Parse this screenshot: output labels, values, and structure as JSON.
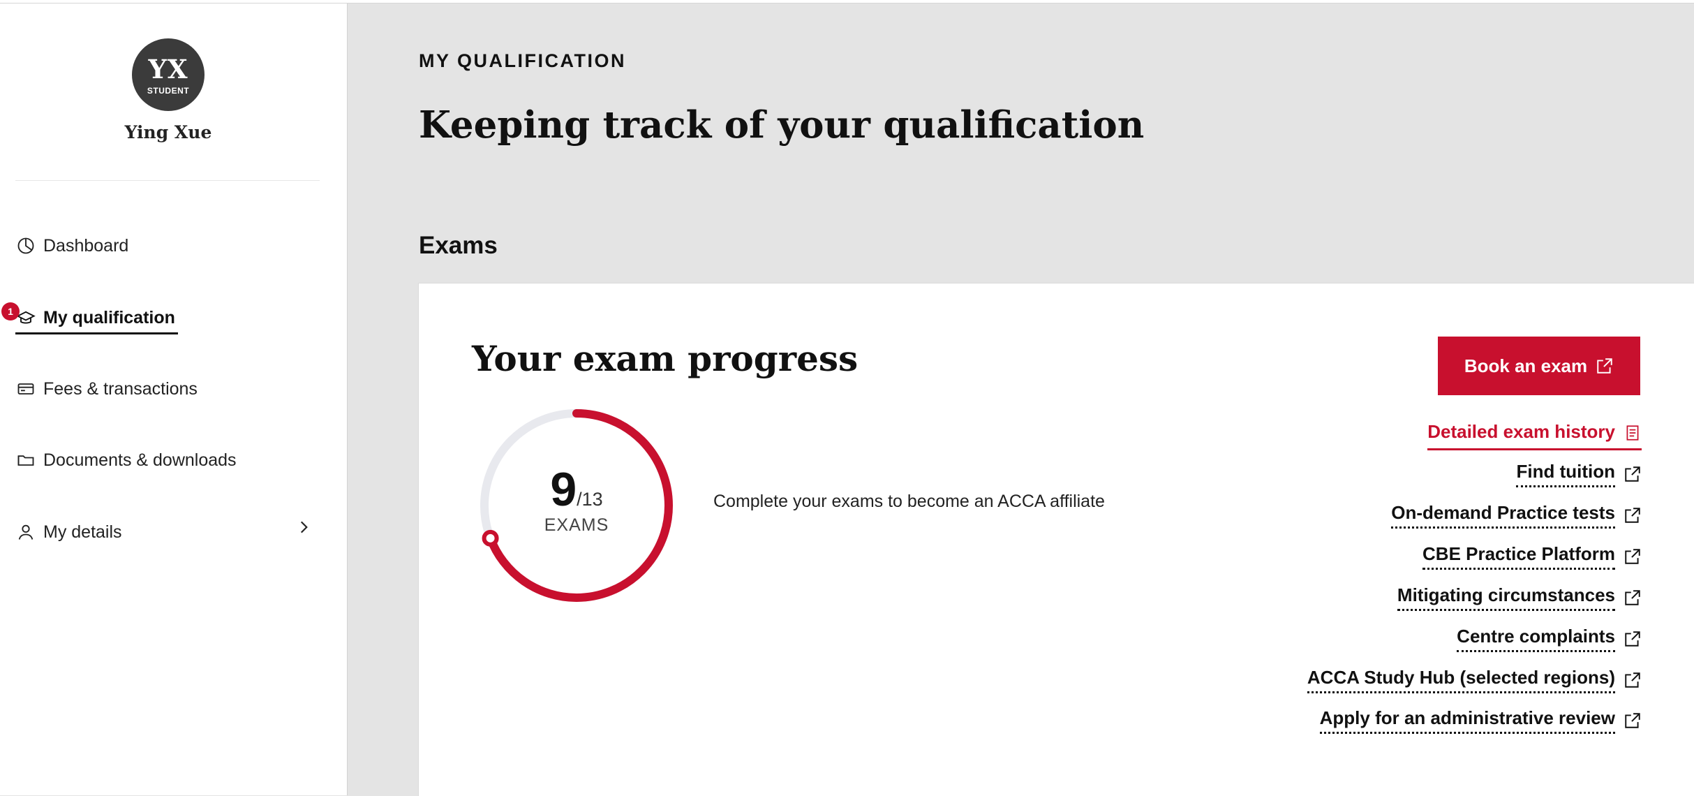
{
  "profile": {
    "initials": "YX",
    "role": "STUDENT",
    "name": "Ying Xue"
  },
  "nav": {
    "items": [
      {
        "label": "Dashboard",
        "icon": "pie-chart-icon"
      },
      {
        "label": "My qualification",
        "icon": "graduation-cap-icon",
        "badge": "1",
        "active": true
      },
      {
        "label": "Fees & transactions",
        "icon": "credit-card-icon"
      },
      {
        "label": "Documents & downloads",
        "icon": "folder-icon"
      },
      {
        "label": "My details",
        "icon": "user-icon"
      }
    ]
  },
  "header": {
    "eyebrow": "MY QUALIFICATION",
    "title": "Keeping track of your qualification"
  },
  "exams": {
    "section_title": "Exams",
    "card_title": "Your exam progress",
    "progress": {
      "completed": "9",
      "total": "/13",
      "unit": "EXAMS",
      "fraction": 0.6923
    },
    "note": "Complete your exams to become an ACCA affiliate",
    "book_button": "Book an exam",
    "links": [
      {
        "label": "Detailed exam history",
        "icon": "document-icon"
      },
      {
        "label": "Find tuition",
        "icon": "external-link-icon"
      },
      {
        "label": "On-demand Practice tests",
        "icon": "external-link-icon"
      },
      {
        "label": "CBE Practice Platform",
        "icon": "external-link-icon"
      },
      {
        "label": "Mitigating circumstances",
        "icon": "external-link-icon"
      },
      {
        "label": "Centre complaints",
        "icon": "external-link-icon"
      },
      {
        "label": "ACCA Study Hub (selected regions)",
        "icon": "external-link-icon"
      },
      {
        "label": "Apply for an administrative review",
        "icon": "external-link-icon"
      }
    ]
  },
  "colors": {
    "brand_red": "#c8102e",
    "track_grey": "#e8e9ee",
    "page_bg": "#e4e4e4"
  }
}
